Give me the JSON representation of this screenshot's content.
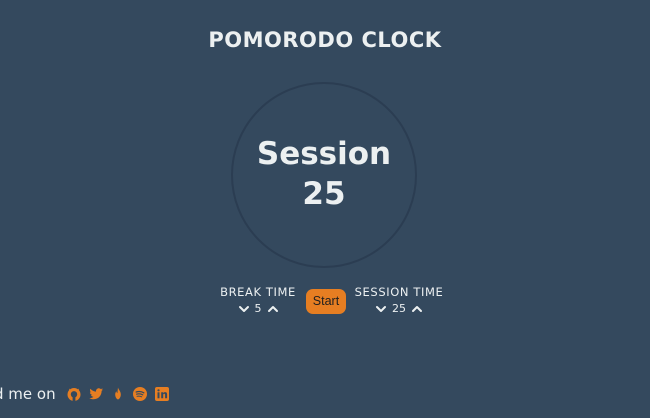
{
  "header": {
    "title": "POMORODO CLOCK"
  },
  "clock": {
    "label": "Session",
    "time": "25"
  },
  "break_control": {
    "label": "BREAK TIME",
    "value": "5"
  },
  "session_control": {
    "label": "SESSION TIME",
    "value": "25"
  },
  "start_button": {
    "label": "Start"
  },
  "footer": {
    "text": "d me on",
    "icons": [
      "github-icon",
      "twitter-icon",
      "fire-icon",
      "spotify-icon",
      "linkedin-icon"
    ]
  },
  "colors": {
    "background": "#34495e",
    "text": "#ecf0f1",
    "accent": "#e67e22",
    "circle_border": "#2b3d52"
  }
}
